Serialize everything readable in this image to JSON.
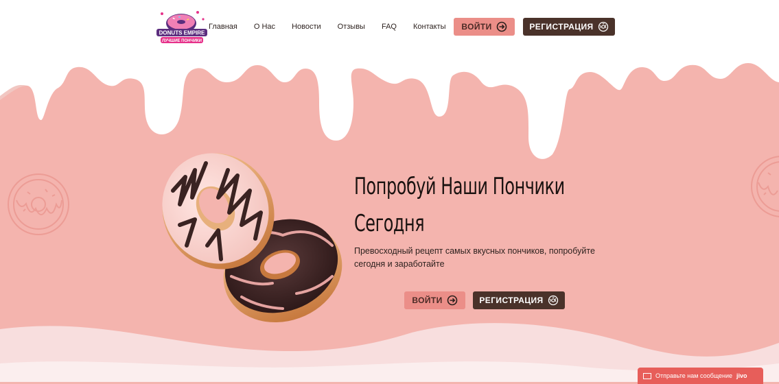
{
  "header": {
    "logo": {
      "title": "DONUTS EMPIRE",
      "tagline": "ЛУЧШИЕ ПОНЧИКИ"
    },
    "nav": [
      {
        "label": "Главная"
      },
      {
        "label": "О Нас"
      },
      {
        "label": "Новости"
      },
      {
        "label": "Отзывы"
      },
      {
        "label": "FAQ"
      },
      {
        "label": "Контакты"
      }
    ],
    "login_label": "ВОЙТИ",
    "register_label": "РЕГИСТРАЦИЯ"
  },
  "hero": {
    "title_line1": "Попробуй Наши Пончики",
    "title_line2": "Сегодня",
    "subtitle": "Превосходный рецепт самых вкусных пончиков, попробуйте сегодня и заработайте",
    "login_label": "ВОЙТИ",
    "register_label": "РЕГИСТРАЦИЯ"
  },
  "chat_widget": {
    "label": "Отправьте нам сообщение",
    "brand": "jivo"
  },
  "colors": {
    "background": "#f4b4ae",
    "login_button": "#eb8e88",
    "register_button": "#4a322a",
    "chat_widget": "#e75e5a"
  },
  "icons": {
    "login": "arrow-right-circle-icon",
    "register": "donut-icon",
    "chat": "envelope-icon"
  }
}
